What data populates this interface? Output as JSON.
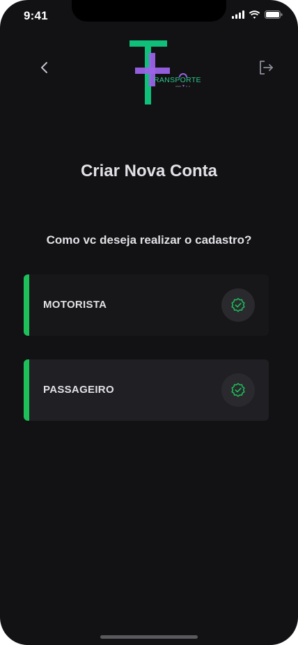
{
  "status_bar": {
    "time": "9:41"
  },
  "logo": {
    "wordmark": "RANSPORTE"
  },
  "header": {
    "title": "Criar Nova Conta"
  },
  "prompt": {
    "question": "Como vc deseja realizar o cadastro?"
  },
  "options": [
    {
      "label": "MOTORISTA",
      "icon": "badge-check-icon"
    },
    {
      "label": "PASSAGEIRO",
      "icon": "badge-check-icon"
    }
  ],
  "colors": {
    "background": "#121214",
    "accent_green": "#1ec05a",
    "logo_green": "#0fbf7a",
    "logo_purple": "#9b63e6",
    "text": "#e1e1e6"
  }
}
